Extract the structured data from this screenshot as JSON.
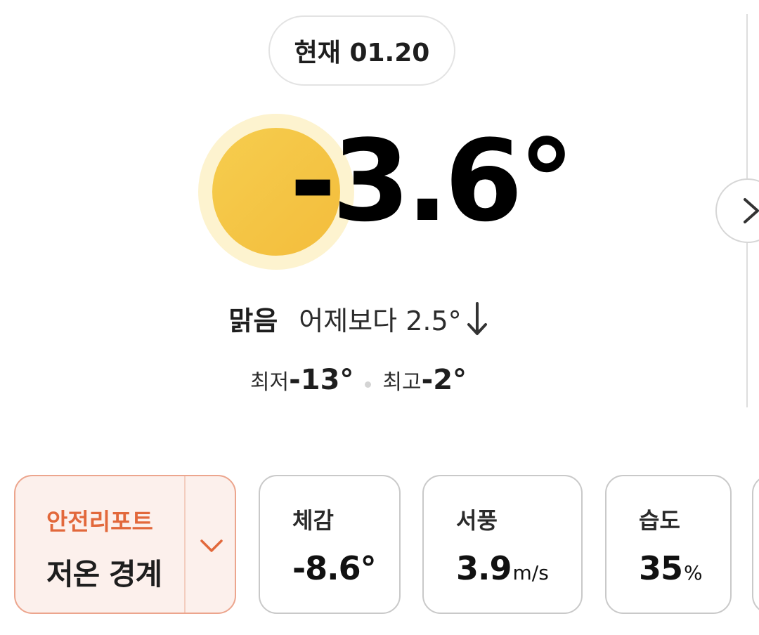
{
  "header": {
    "date_label": "현재 01.20"
  },
  "current": {
    "temperature": "-3.6°",
    "condition": "맑음",
    "comparison": "어제보다 2.5°",
    "comparison_direction": "down",
    "low_label": "최저",
    "low_value": "-13°",
    "high_label": "최고",
    "high_value": "-2°",
    "weather_icon": "sun-icon"
  },
  "cards": {
    "safety": {
      "title": "안전리포트",
      "value": "저온 경계"
    },
    "feels_like": {
      "title": "체감",
      "value": "-8.6°"
    },
    "wind": {
      "title": "서풍",
      "value": "3.9",
      "unit": "m/s"
    },
    "humidity": {
      "title": "습도",
      "value": "35",
      "unit": "%"
    }
  },
  "colors": {
    "sun": "#f4c444",
    "sun_halo": "#fdf3cf",
    "safety_accent": "#e2683b",
    "safety_bg": "#fcf0ec",
    "safety_border": "#eca58d"
  }
}
